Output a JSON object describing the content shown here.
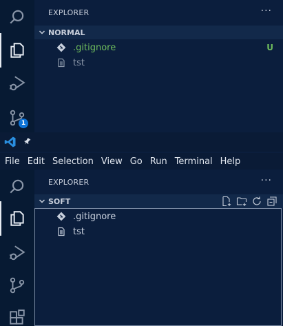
{
  "top": {
    "explorer_title": "EXPLORER",
    "more": "···",
    "section_label": "NORMAL",
    "scm_badge": "1",
    "files": [
      {
        "name": ".gitignore",
        "status": "U",
        "icon": "git-diamond-icon",
        "color": "#6fbd5d"
      },
      {
        "name": "tst",
        "status": "",
        "icon": "file-lines-icon",
        "color": "#8a96a8"
      }
    ]
  },
  "menu": {
    "items": [
      "File",
      "Edit",
      "Selection",
      "View",
      "Go",
      "Run",
      "Terminal",
      "Help"
    ]
  },
  "bottom": {
    "explorer_title": "EXPLORER",
    "more": "···",
    "section_label": "SOFT",
    "files": [
      {
        "name": ".gitignore",
        "icon": "git-diamond-icon",
        "color": "#c9d1de"
      },
      {
        "name": "tst",
        "icon": "file-lines-icon",
        "color": "#c9d1de"
      }
    ]
  },
  "colors": {
    "background": "#0b1e3d",
    "activity_bar": "#071a33",
    "section_header": "#12294a",
    "untracked_green": "#6fbd5d",
    "badge_blue": "#0e74d8",
    "vscode_blue": "#2a8fe0"
  }
}
